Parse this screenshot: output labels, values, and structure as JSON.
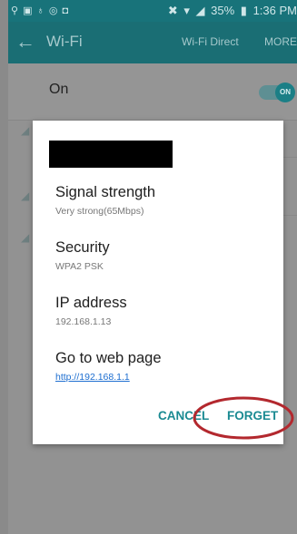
{
  "status_bar": {
    "left_icons": "⚲ ▣ ♁ ◎ ◘",
    "battery": "35%",
    "time": "1:36 PM"
  },
  "action_bar": {
    "back_icon": "←",
    "title": "Wi-Fi",
    "wifi_direct_label": "Wi-Fi Direct",
    "more_label": "MORE"
  },
  "wifi_toggle": {
    "label": "On",
    "switch_text": "ON"
  },
  "dialog": {
    "items": [
      {
        "title": "Signal strength",
        "value": "Very strong(65Mbps)"
      },
      {
        "title": "Security",
        "value": "WPA2 PSK"
      },
      {
        "title": "IP address",
        "value": "192.168.1.13"
      },
      {
        "title": "Go to web page",
        "value": "http://192.168.1.1"
      }
    ],
    "cancel_label": "CANCEL",
    "forget_label": "FORGET"
  },
  "colors": {
    "accent": "#1a8a92",
    "status_bar": "#18737a",
    "annotation": "#b3282e"
  }
}
